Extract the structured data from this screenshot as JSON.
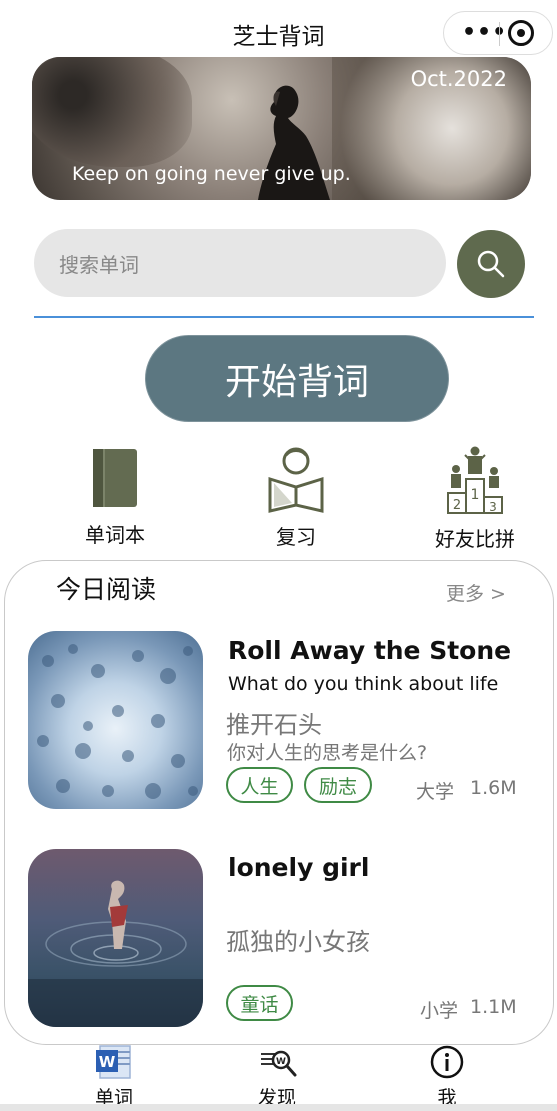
{
  "nav": {
    "title": "芝士背词"
  },
  "banner": {
    "date": "Oct.2022",
    "caption": "Keep on going never give up."
  },
  "search": {
    "placeholder": "搜索单词"
  },
  "start": {
    "label": "开始背词"
  },
  "features": [
    {
      "label": "单词本",
      "icon": "book-icon"
    },
    {
      "label": "复习",
      "icon": "person-reading-icon"
    },
    {
      "label": "好友比拼",
      "icon": "podium-icon"
    }
  ],
  "reading": {
    "title": "今日阅读",
    "more": "更多 >",
    "items": [
      {
        "title_en": "Roll Away the Stone",
        "subtitle_en": "What do you think about life",
        "title_cn": "推开石头",
        "subtitle_cn": "你对人生的思考是什么?",
        "tags": [
          "人生",
          "励志"
        ],
        "level": "大学",
        "size": "1.6M"
      },
      {
        "title_en": "lonely girl",
        "subtitle_en": "",
        "title_cn": "孤独的小女孩",
        "subtitle_cn": "",
        "tags": [
          "童话"
        ],
        "level": "小学",
        "size": "1.1M"
      }
    ]
  },
  "tabs": [
    {
      "label": "单词",
      "icon": "word-doc-icon"
    },
    {
      "label": "发现",
      "icon": "discover-icon"
    },
    {
      "label": "我",
      "icon": "info-icon"
    }
  ],
  "colors": {
    "accent_green": "#5f6a4e",
    "start_button": "#5c7781",
    "tag_green": "#3f8a45",
    "divider_blue": "#4a90d9"
  }
}
